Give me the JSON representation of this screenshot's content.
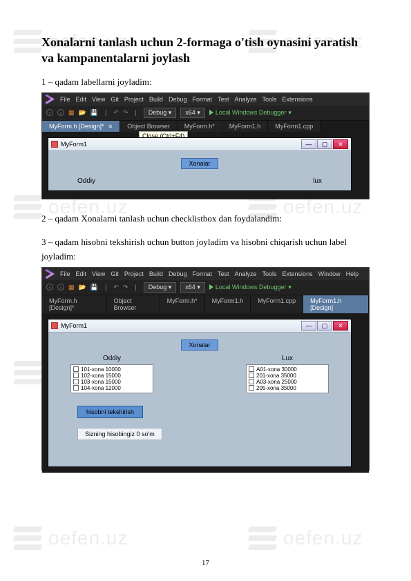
{
  "watermark_text": "oefen.uz",
  "title": "Xonalarni tanlash uchun 2-formaga o'tish oynasini yaratish va kampanentalarni joylash",
  "step1": "1 – qadam labellarni joyladim:",
  "step2": "2 – qadam Xonalarni tanlash uchun checklistbox dan foydalandim:",
  "step3": "3 – qadam hisobni tekshirish uchun button joyladim va hisobni chiqarish uchun label joyladim:",
  "page_number": "17",
  "vs": {
    "menu": {
      "file": "File",
      "edit": "Edit",
      "view": "View",
      "git": "Git",
      "project": "Project",
      "build": "Build",
      "debug": "Debug",
      "format": "Format",
      "test": "Test",
      "analyze": "Analyze",
      "tools": "Tools",
      "extensions": "Extensions",
      "window": "Window",
      "help": "Help"
    },
    "config": "Debug",
    "platform": "x64",
    "run": "Local Windows Debugger",
    "tabs": {
      "designer": "MyForm.h [Design]*",
      "objbrowser": "Object Browser",
      "formh": "MyForm.h*",
      "form1h": "MyForm1.h",
      "form1cpp": "MyForm1.cpp",
      "form1design": "MyForm1.h [Design]"
    },
    "tooltip_close": "Close (Ctrl+F4)"
  },
  "form1": {
    "title": "MyForm1",
    "xonalar": "Xonalar",
    "oddiy": "Oddiy",
    "lux": "lux"
  },
  "form2": {
    "title": "MyForm1",
    "xonalar": "Xonalar",
    "oddiy": "Oddiy",
    "lux": "Lux",
    "items_left": [
      "101-xona 10000",
      "102-xona 15000",
      "103-xona 15000",
      "104-xona 12000"
    ],
    "items_right": [
      "A01-xona 30000",
      "201-xona 35000",
      "A03-xona 25000",
      "205-xona 35000"
    ],
    "calc_btn": "hisobni tekshirish",
    "total_label": "Sizning hisobingiz 0 so'm"
  }
}
